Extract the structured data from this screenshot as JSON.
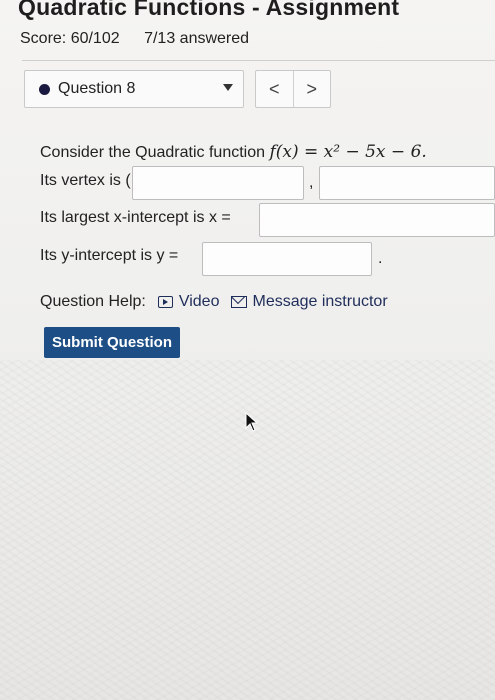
{
  "header": {
    "title": "Quadratic Functions - Assignment",
    "score": "Score: 60/102",
    "answered": "7/13 answered"
  },
  "question_nav": {
    "selected": "Question 8",
    "prev_label": "<",
    "next_label": ">"
  },
  "question": {
    "intro": "Consider the Quadratic function",
    "function": "f(x) = x² − 5x − 6.",
    "vertex_label": "Its vertex is (",
    "vertex_sep": ",",
    "largest_x_label": "Its largest x-intercept is x =",
    "y_intercept_label": "Its y-intercept is y =",
    "y_intercept_end": "."
  },
  "help": {
    "label": "Question Help:",
    "video": "Video",
    "message": "Message instructor"
  },
  "submit_label": "Submit Question",
  "colors": {
    "submit_bg": "#1e4e86",
    "link": "#1f2d5a"
  }
}
